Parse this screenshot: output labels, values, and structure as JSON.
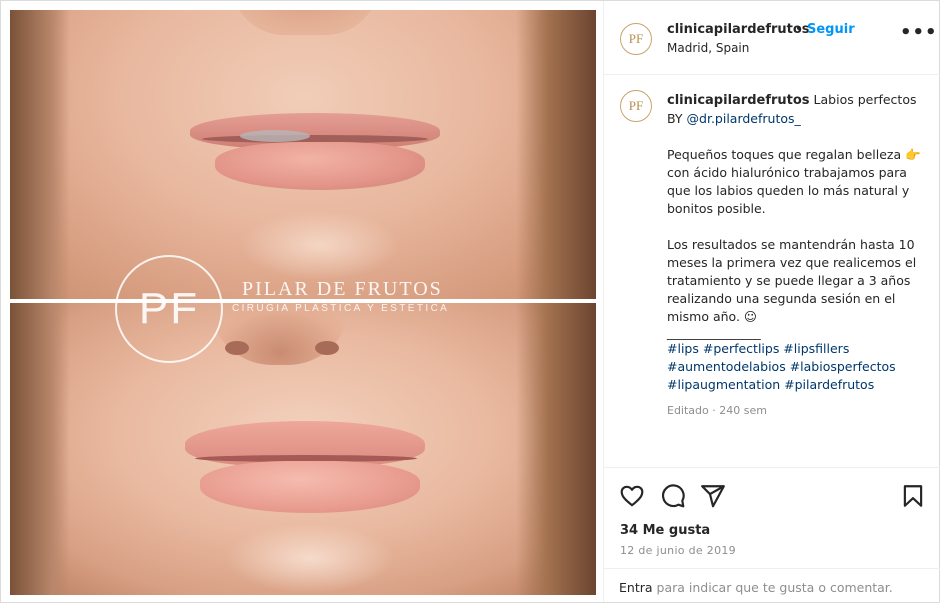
{
  "header": {
    "username": "clinicapilardefrutos",
    "separator": "•",
    "follow_label": "Seguir",
    "location": "Madrid, Spain",
    "avatar_text": "PF",
    "more_label": "•••"
  },
  "watermark": {
    "logo": "PF",
    "name": "PILAR DE FRUTOS",
    "sub": "CIRUGÍA PLÁSTICA Y ESTÉTICA"
  },
  "caption": {
    "username": "clinicapilardefrutos",
    "title": "Labios perfectos BY",
    "mention": "@dr.pilardefrutos_",
    "para1_emoji": "👉",
    "para1_a": "Pequeños toques que regalan belleza",
    "para1_b": "con ácido hialurónico trabajamos para que los labios queden lo más natural y bonitos posible.",
    "para2": "Los resultados se mantendrán hasta 10 meses la primera vez que realicemos el tratamiento y se puede llegar a 3 años realizando una segunda sesión en el mismo año. ☺",
    "separator": "_______________",
    "hashtags": "#lips #perfectlips #lipsfillers #aumentodelabios #labiosperfectos #lipaugmentation #pilardefrutos",
    "meta": "Editado · 240 sem"
  },
  "actions": {
    "likes": "34 Me gusta",
    "date": "12 de junio de 2019",
    "like_icon": "heart-icon",
    "comment_icon": "comment-icon",
    "share_icon": "share-icon",
    "save_icon": "bookmark-icon"
  },
  "comment": {
    "post_label": "Entra",
    "placeholder": "para indicar que te gusta o comentar."
  },
  "colors": {
    "accent": "#0095f6",
    "link": "#00376b",
    "muted": "#8e8e8e",
    "avatar_gold": "#c9a46a"
  }
}
